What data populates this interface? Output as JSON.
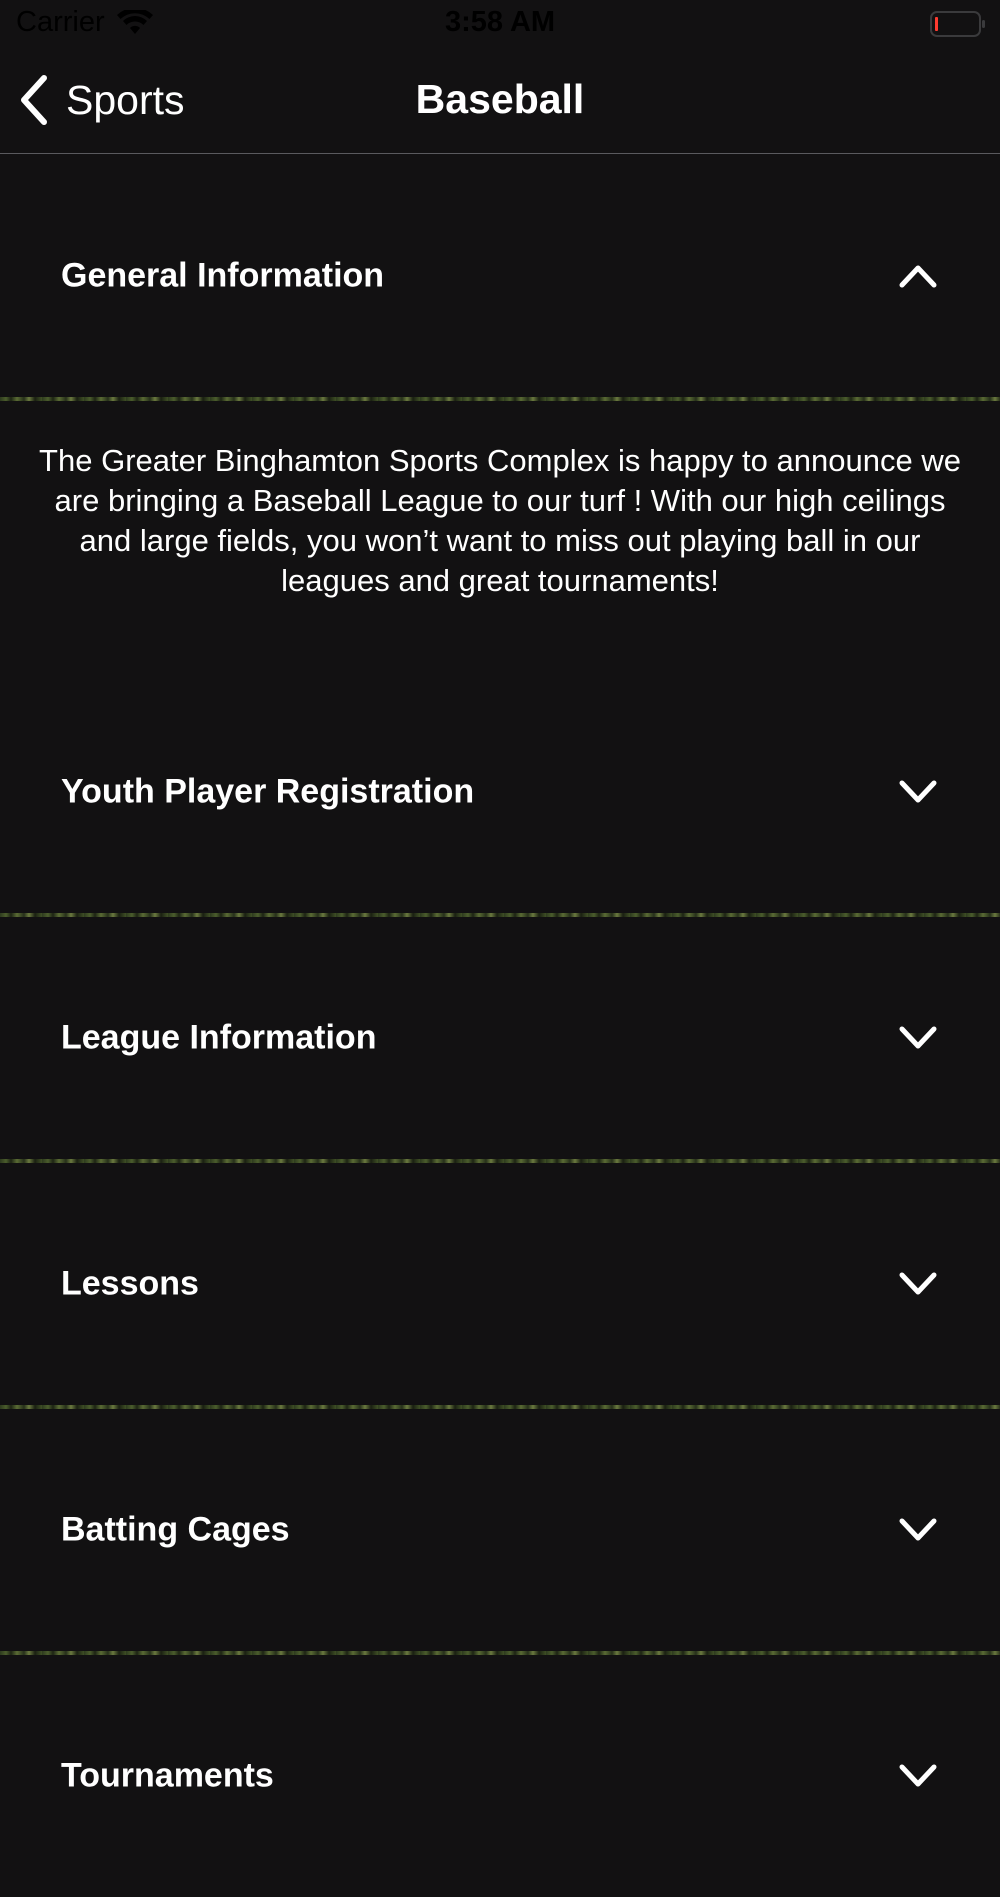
{
  "status_bar": {
    "carrier": "Carrier",
    "time": "3:58 AM",
    "wifi_icon": "wifi-icon",
    "battery_icon": "battery-low-icon",
    "battery_color": "#ff3b30"
  },
  "nav": {
    "back_label": "Sports",
    "back_icon": "chevron-left-icon",
    "title": "Baseball"
  },
  "sections": [
    {
      "title": "General Information",
      "expanded": true,
      "icon": "chevron-up-icon",
      "body": "The Greater Binghamton Sports Complex is happy to announce we are bringing a Baseball League to our turf ! With our high ceilings and large fields, you won’t want to miss out playing ball in our leagues and great tournaments!"
    },
    {
      "title": "Youth Player Registration",
      "expanded": false,
      "icon": "chevron-down-icon"
    },
    {
      "title": "League Information",
      "expanded": false,
      "icon": "chevron-down-icon"
    },
    {
      "title": "Lessons",
      "expanded": false,
      "icon": "chevron-down-icon"
    },
    {
      "title": "Batting Cages",
      "expanded": false,
      "icon": "chevron-down-icon"
    },
    {
      "title": "Tournaments",
      "expanded": false,
      "icon": "chevron-down-icon"
    }
  ],
  "colors": {
    "background": "#121112",
    "text": "#ffffff",
    "divider_turf": "#4b5d2c"
  }
}
